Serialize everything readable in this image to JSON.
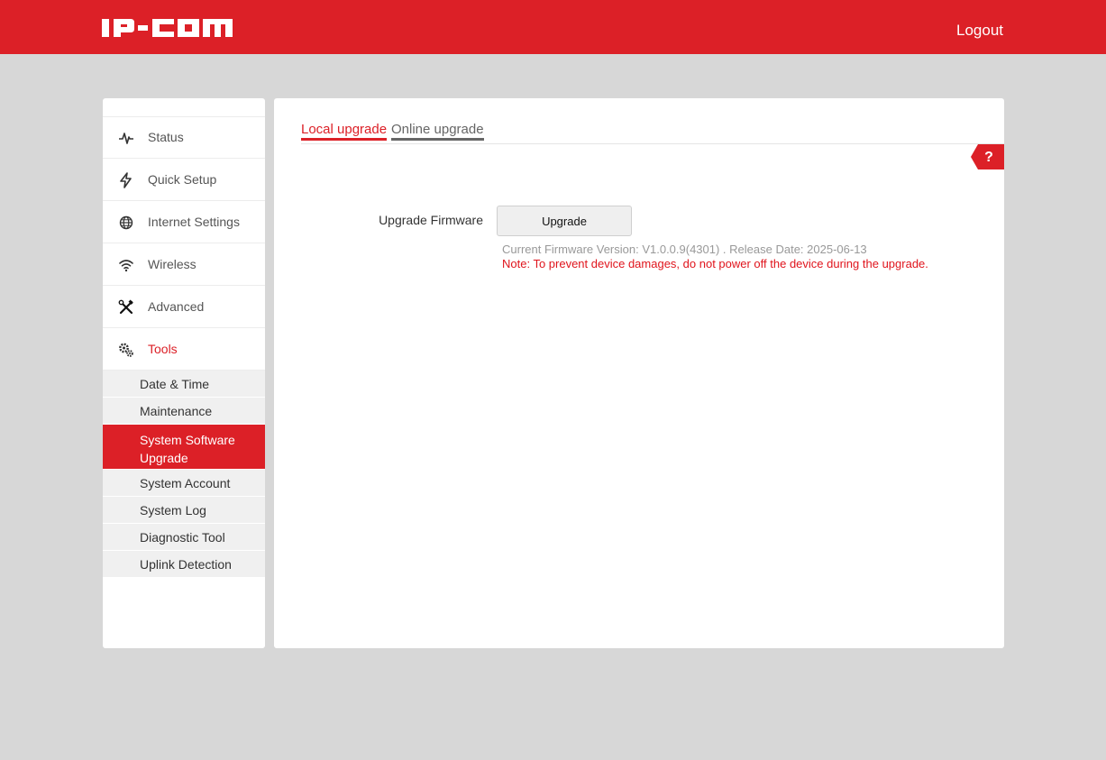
{
  "header": {
    "logo_text": "IP-COM",
    "logout_label": "Logout"
  },
  "sidebar": {
    "items": [
      {
        "label": "Status",
        "icon": "pulse-icon"
      },
      {
        "label": "Quick Setup",
        "icon": "lightning-icon"
      },
      {
        "label": "Internet Settings",
        "icon": "globe-icon"
      },
      {
        "label": "Wireless",
        "icon": "wifi-icon"
      },
      {
        "label": "Advanced",
        "icon": "tools-icon"
      },
      {
        "label": "Tools",
        "icon": "gears-icon",
        "active": true
      }
    ],
    "subitems": [
      {
        "label": "Date & Time"
      },
      {
        "label": "Maintenance"
      },
      {
        "label": "System Software Upgrade",
        "active": true
      },
      {
        "label": "System Account"
      },
      {
        "label": "System Log"
      },
      {
        "label": "Diagnostic Tool"
      },
      {
        "label": "Uplink Detection"
      }
    ]
  },
  "main": {
    "tabs": [
      {
        "label": "Local upgrade",
        "active": true
      },
      {
        "label": "Online upgrade",
        "active": false
      }
    ],
    "help_label": "?",
    "upgrade_firmware_label": "Upgrade Firmware",
    "upgrade_button_label": "Upgrade",
    "firmware_info": "Current Firmware Version: V1.0.0.9(4301) . Release Date: 2025-06-13",
    "note": "Note: To prevent device damages, do not power off the device during the upgrade."
  },
  "colors": {
    "brand_red": "#dc2027",
    "background": "#d7d7d7",
    "note_red": "#e0141c"
  }
}
